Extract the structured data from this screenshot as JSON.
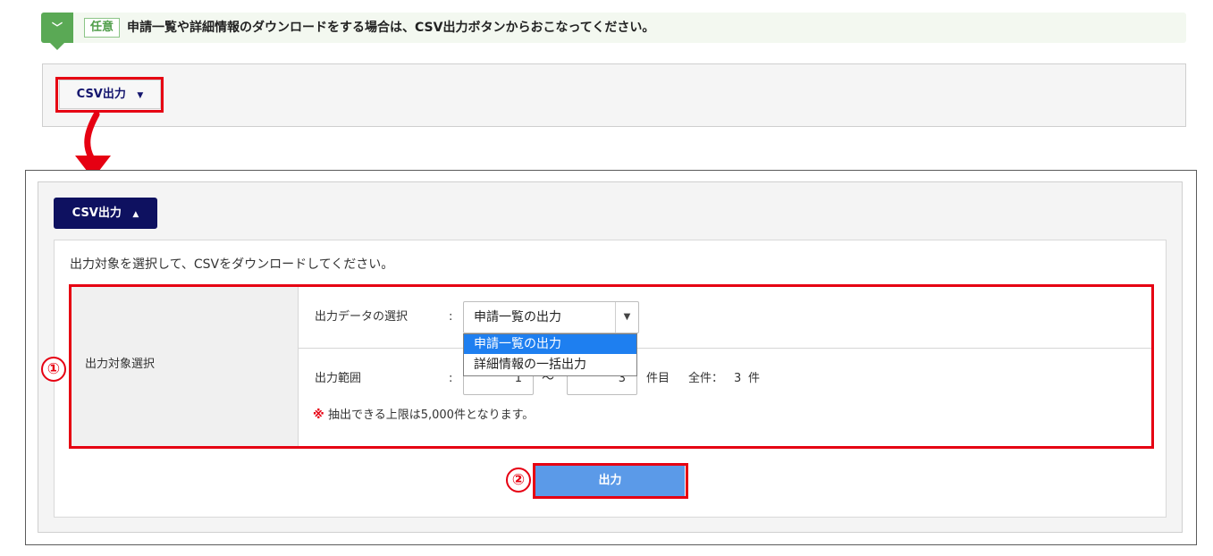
{
  "hint": {
    "tag": "任意",
    "text": "申請一覧や詳細情報のダウンロードをする場合は、CSV出力ボタンからおこなってください。"
  },
  "csv_button_collapsed": {
    "label": "CSV出力",
    "caret": "▼"
  },
  "csv_button_expanded": {
    "label": "CSV出力",
    "caret": "▲"
  },
  "panel": {
    "instruction": "出力対象を選択して、CSVをダウンロードしてください。",
    "section_label": "出力対象選択",
    "data_select": {
      "label": "出力データの選択",
      "colon": ":",
      "value": "申請一覧の出力",
      "caret": "▼",
      "options": [
        "申請一覧の出力",
        "詳細情報の一括出力"
      ],
      "selected_index": 0
    },
    "range": {
      "label": "出力範囲",
      "colon": ":",
      "from": "1",
      "tilde": "〜",
      "to": "3",
      "unit": "件目",
      "total_label": "全件：",
      "total_count": "3",
      "total_unit": "件"
    },
    "note": {
      "mark": "※",
      "text": "抽出できる上限は5,000件となります。"
    },
    "submit_label": "出力"
  },
  "callouts": {
    "one": "①",
    "two": "②"
  },
  "colors": {
    "accent_red": "#e60012",
    "navy": "#0e1160",
    "hint_green": "#5aa955",
    "submit_blue": "#5b9ae8",
    "dropdown_highlight": "#1e7ff0"
  }
}
